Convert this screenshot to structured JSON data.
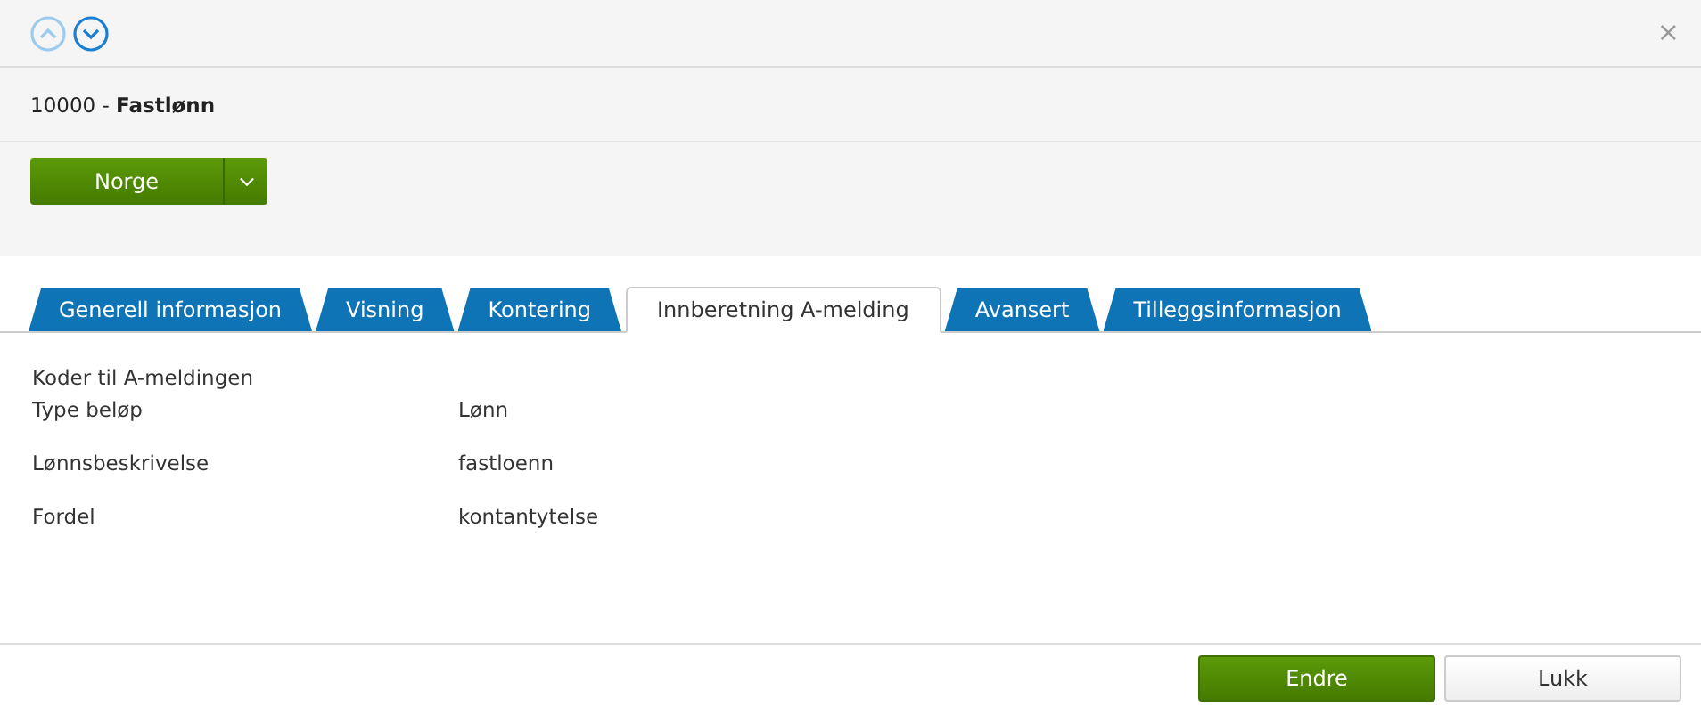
{
  "nav": [
    {
      "kind": "up",
      "disabled": true
    },
    {
      "kind": "down",
      "disabled": false
    }
  ],
  "close": "×",
  "title": "10000 - **Fastlønn**",
  "country_button": {
    "label": "Norge"
  },
  "tabs": [
    {
      "label": "Generell informasjon",
      "selected": false
    },
    {
      "label": "Visning",
      "selected": false
    },
    {
      "label": "Kontering",
      "selected": false
    },
    {
      "label": "Innberetning A-melding",
      "selected": true
    },
    {
      "label": "Avansert",
      "selected": false
    },
    {
      "label": "Tilleggsinformasjon",
      "selected": false
    }
  ],
  "section_title": "Koder til A-meldingen",
  "fields": [
    {
      "label": "Type beløp",
      "value": "Lønn"
    },
    {
      "label": "Lønnsbeskrivelse",
      "value": "fastloenn"
    },
    {
      "label": "Fordel",
      "value": "kontantytelse"
    }
  ],
  "buttons": [
    {
      "label": "Endre",
      "kind": "primary"
    },
    {
      "label": "Lukk",
      "kind": "secondary"
    }
  ]
}
